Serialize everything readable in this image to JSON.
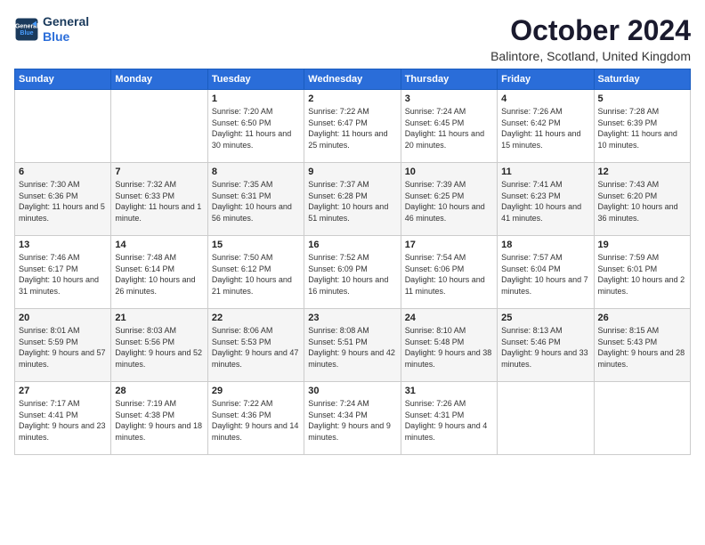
{
  "logo": {
    "line1": "General",
    "line2": "Blue"
  },
  "header": {
    "month": "October 2024",
    "location": "Balintore, Scotland, United Kingdom"
  },
  "columns": [
    "Sunday",
    "Monday",
    "Tuesday",
    "Wednesday",
    "Thursday",
    "Friday",
    "Saturday"
  ],
  "weeks": [
    [
      {
        "day": "",
        "sunrise": "",
        "sunset": "",
        "daylight": ""
      },
      {
        "day": "",
        "sunrise": "",
        "sunset": "",
        "daylight": ""
      },
      {
        "day": "1",
        "sunrise": "Sunrise: 7:20 AM",
        "sunset": "Sunset: 6:50 PM",
        "daylight": "Daylight: 11 hours and 30 minutes."
      },
      {
        "day": "2",
        "sunrise": "Sunrise: 7:22 AM",
        "sunset": "Sunset: 6:47 PM",
        "daylight": "Daylight: 11 hours and 25 minutes."
      },
      {
        "day": "3",
        "sunrise": "Sunrise: 7:24 AM",
        "sunset": "Sunset: 6:45 PM",
        "daylight": "Daylight: 11 hours and 20 minutes."
      },
      {
        "day": "4",
        "sunrise": "Sunrise: 7:26 AM",
        "sunset": "Sunset: 6:42 PM",
        "daylight": "Daylight: 11 hours and 15 minutes."
      },
      {
        "day": "5",
        "sunrise": "Sunrise: 7:28 AM",
        "sunset": "Sunset: 6:39 PM",
        "daylight": "Daylight: 11 hours and 10 minutes."
      }
    ],
    [
      {
        "day": "6",
        "sunrise": "Sunrise: 7:30 AM",
        "sunset": "Sunset: 6:36 PM",
        "daylight": "Daylight: 11 hours and 5 minutes."
      },
      {
        "day": "7",
        "sunrise": "Sunrise: 7:32 AM",
        "sunset": "Sunset: 6:33 PM",
        "daylight": "Daylight: 11 hours and 1 minute."
      },
      {
        "day": "8",
        "sunrise": "Sunrise: 7:35 AM",
        "sunset": "Sunset: 6:31 PM",
        "daylight": "Daylight: 10 hours and 56 minutes."
      },
      {
        "day": "9",
        "sunrise": "Sunrise: 7:37 AM",
        "sunset": "Sunset: 6:28 PM",
        "daylight": "Daylight: 10 hours and 51 minutes."
      },
      {
        "day": "10",
        "sunrise": "Sunrise: 7:39 AM",
        "sunset": "Sunset: 6:25 PM",
        "daylight": "Daylight: 10 hours and 46 minutes."
      },
      {
        "day": "11",
        "sunrise": "Sunrise: 7:41 AM",
        "sunset": "Sunset: 6:23 PM",
        "daylight": "Daylight: 10 hours and 41 minutes."
      },
      {
        "day": "12",
        "sunrise": "Sunrise: 7:43 AM",
        "sunset": "Sunset: 6:20 PM",
        "daylight": "Daylight: 10 hours and 36 minutes."
      }
    ],
    [
      {
        "day": "13",
        "sunrise": "Sunrise: 7:46 AM",
        "sunset": "Sunset: 6:17 PM",
        "daylight": "Daylight: 10 hours and 31 minutes."
      },
      {
        "day": "14",
        "sunrise": "Sunrise: 7:48 AM",
        "sunset": "Sunset: 6:14 PM",
        "daylight": "Daylight: 10 hours and 26 minutes."
      },
      {
        "day": "15",
        "sunrise": "Sunrise: 7:50 AM",
        "sunset": "Sunset: 6:12 PM",
        "daylight": "Daylight: 10 hours and 21 minutes."
      },
      {
        "day": "16",
        "sunrise": "Sunrise: 7:52 AM",
        "sunset": "Sunset: 6:09 PM",
        "daylight": "Daylight: 10 hours and 16 minutes."
      },
      {
        "day": "17",
        "sunrise": "Sunrise: 7:54 AM",
        "sunset": "Sunset: 6:06 PM",
        "daylight": "Daylight: 10 hours and 11 minutes."
      },
      {
        "day": "18",
        "sunrise": "Sunrise: 7:57 AM",
        "sunset": "Sunset: 6:04 PM",
        "daylight": "Daylight: 10 hours and 7 minutes."
      },
      {
        "day": "19",
        "sunrise": "Sunrise: 7:59 AM",
        "sunset": "Sunset: 6:01 PM",
        "daylight": "Daylight: 10 hours and 2 minutes."
      }
    ],
    [
      {
        "day": "20",
        "sunrise": "Sunrise: 8:01 AM",
        "sunset": "Sunset: 5:59 PM",
        "daylight": "Daylight: 9 hours and 57 minutes."
      },
      {
        "day": "21",
        "sunrise": "Sunrise: 8:03 AM",
        "sunset": "Sunset: 5:56 PM",
        "daylight": "Daylight: 9 hours and 52 minutes."
      },
      {
        "day": "22",
        "sunrise": "Sunrise: 8:06 AM",
        "sunset": "Sunset: 5:53 PM",
        "daylight": "Daylight: 9 hours and 47 minutes."
      },
      {
        "day": "23",
        "sunrise": "Sunrise: 8:08 AM",
        "sunset": "Sunset: 5:51 PM",
        "daylight": "Daylight: 9 hours and 42 minutes."
      },
      {
        "day": "24",
        "sunrise": "Sunrise: 8:10 AM",
        "sunset": "Sunset: 5:48 PM",
        "daylight": "Daylight: 9 hours and 38 minutes."
      },
      {
        "day": "25",
        "sunrise": "Sunrise: 8:13 AM",
        "sunset": "Sunset: 5:46 PM",
        "daylight": "Daylight: 9 hours and 33 minutes."
      },
      {
        "day": "26",
        "sunrise": "Sunrise: 8:15 AM",
        "sunset": "Sunset: 5:43 PM",
        "daylight": "Daylight: 9 hours and 28 minutes."
      }
    ],
    [
      {
        "day": "27",
        "sunrise": "Sunrise: 7:17 AM",
        "sunset": "Sunset: 4:41 PM",
        "daylight": "Daylight: 9 hours and 23 minutes."
      },
      {
        "day": "28",
        "sunrise": "Sunrise: 7:19 AM",
        "sunset": "Sunset: 4:38 PM",
        "daylight": "Daylight: 9 hours and 18 minutes."
      },
      {
        "day": "29",
        "sunrise": "Sunrise: 7:22 AM",
        "sunset": "Sunset: 4:36 PM",
        "daylight": "Daylight: 9 hours and 14 minutes."
      },
      {
        "day": "30",
        "sunrise": "Sunrise: 7:24 AM",
        "sunset": "Sunset: 4:34 PM",
        "daylight": "Daylight: 9 hours and 9 minutes."
      },
      {
        "day": "31",
        "sunrise": "Sunrise: 7:26 AM",
        "sunset": "Sunset: 4:31 PM",
        "daylight": "Daylight: 9 hours and 4 minutes."
      },
      {
        "day": "",
        "sunrise": "",
        "sunset": "",
        "daylight": ""
      },
      {
        "day": "",
        "sunrise": "",
        "sunset": "",
        "daylight": ""
      }
    ]
  ]
}
